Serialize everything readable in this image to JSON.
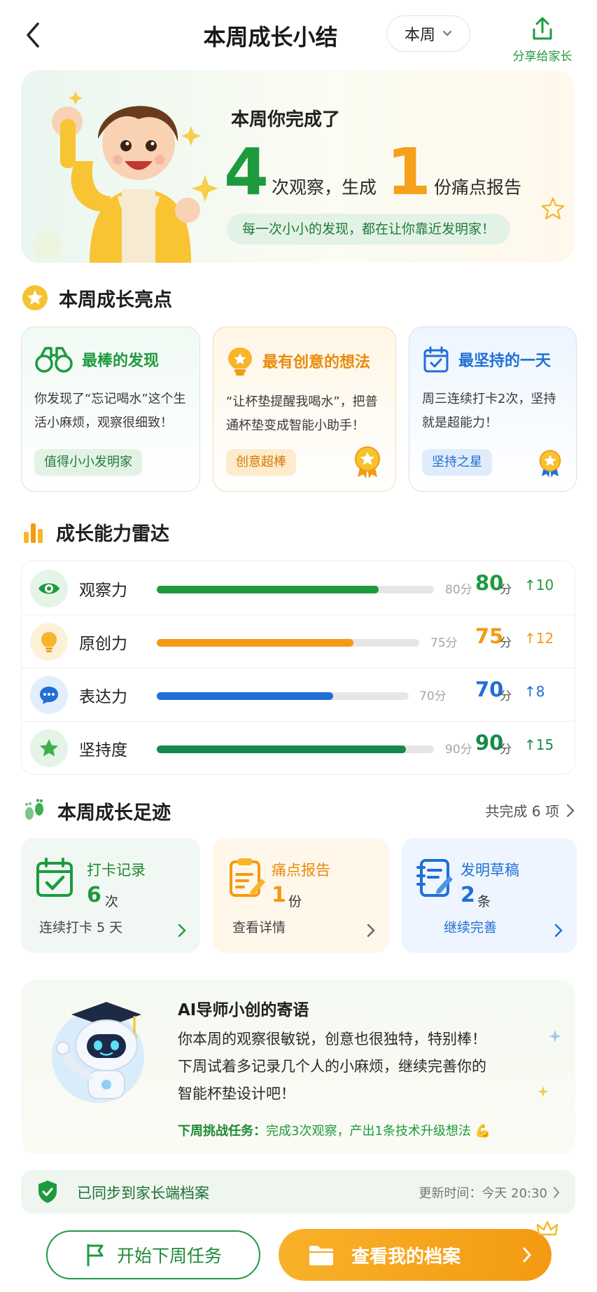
{
  "header": {
    "title": "本周成长小结",
    "period": "本周",
    "share_label": "分享给家长"
  },
  "hero": {
    "title": "本周你完成了",
    "observations": "4",
    "obs_text": "次观察，生成",
    "reports": "1",
    "reports_text": "份痛点报告",
    "slogan": "每一次小小的发现，都在让你靠近发明家！"
  },
  "highlights": {
    "title": "本周成长亮点",
    "cards": [
      {
        "title": "最棒的发现",
        "desc": "你发现了“忘记喝水”这个生活小麻烦，观察很细致！",
        "tag": "值得小小发明家"
      },
      {
        "title": "最有创意的想法",
        "desc": "“让杯垫提醒我喝水”，把普通杯垫变成智能小助手！",
        "tag": "创意超棒"
      },
      {
        "title": "最坚持的一天",
        "desc": "周三连续打卡2次，坚持就是超能力！",
        "tag": "坚持之星"
      }
    ]
  },
  "radar": {
    "title": "成长能力雷达",
    "unit": "分",
    "rows": [
      {
        "label": "观察力",
        "score": "80",
        "cap": "80分",
        "delta": "10",
        "level": 80,
        "color": "#1e9a3e"
      },
      {
        "label": "原创力",
        "score": "75",
        "cap": "75分",
        "delta": "12",
        "level": 75,
        "color": "#f39a12"
      },
      {
        "label": "表达力",
        "score": "70",
        "cap": "70分",
        "delta": "8",
        "level": 70,
        "color": "#1f6fd6"
      },
      {
        "label": "坚持度",
        "score": "90",
        "cap": "90分",
        "delta": "15",
        "level": 90,
        "color": "#168a4a"
      }
    ]
  },
  "footprints": {
    "title": "本周成长足迹",
    "total": "共完成 6 项",
    "cards": [
      {
        "name": "打卡记录",
        "num": "6",
        "unit": "次",
        "foot": "连续打卡 5 天"
      },
      {
        "name": "痛点报告",
        "num": "1",
        "unit": "份",
        "foot": "查看详情"
      },
      {
        "name": "发明草稿",
        "num": "2",
        "unit": "条",
        "foot": "继续完善"
      }
    ]
  },
  "mentor": {
    "title": "AI导师小创的寄语",
    "lines": [
      "你本周的观察很敏锐，创意也很独特，特别棒！",
      "下周试着多记录几个人的小麻烦，继续完善你的",
      "智能杯垫设计吧！"
    ],
    "task_label": "下周挑战任务：",
    "task_text": "完成3次观察，产出1条技术升级想法 💪"
  },
  "sync": {
    "text": "已同步到家长端档案",
    "time": "更新时间：今天 20:30"
  },
  "buttons": {
    "next": "开始下周任务",
    "profile": "查看我的档案"
  }
}
